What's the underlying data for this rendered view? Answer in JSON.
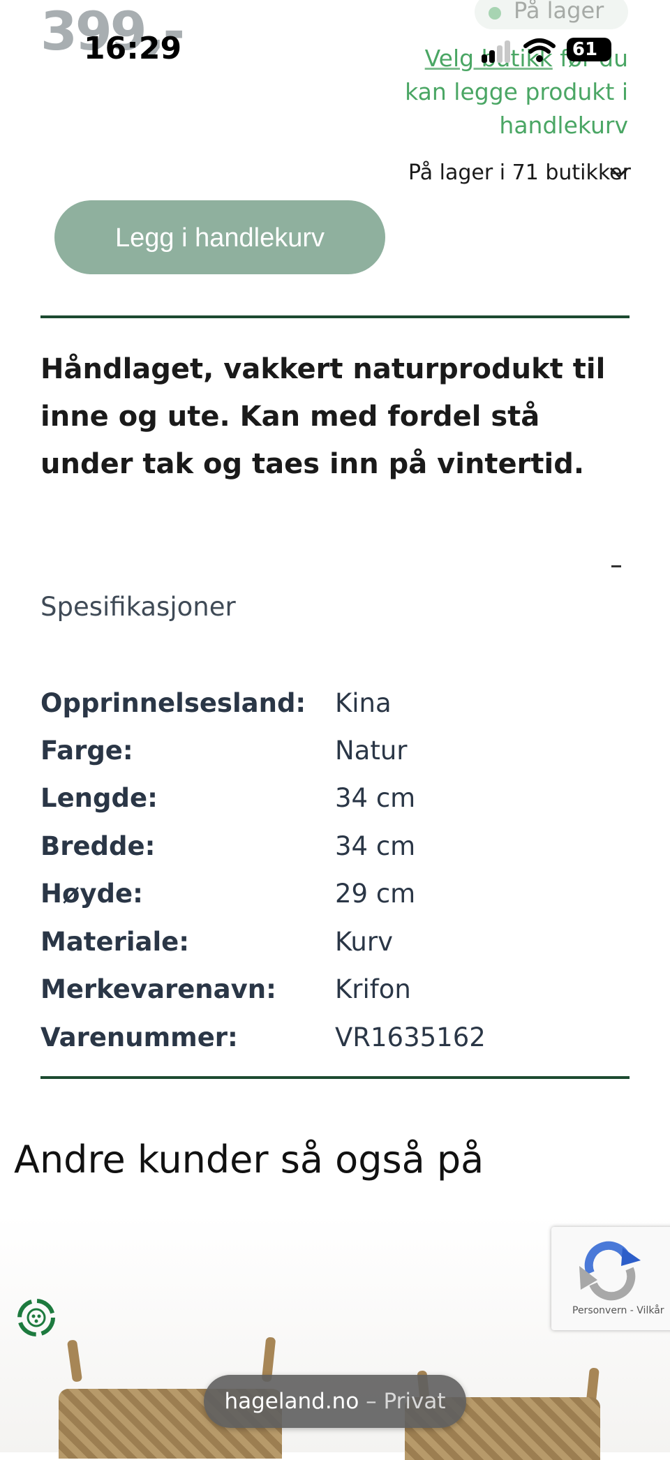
{
  "status_bar": {
    "time": "16:29",
    "battery": "61"
  },
  "product": {
    "price": "399,-",
    "stock_label": "På lager",
    "store_msg_link": "Velg butikk",
    "store_msg_rest": " før du kan legge produkt i handlekurv",
    "stock_count": "På lager i 71 butikker",
    "add_to_cart": "Legg i handlekurv",
    "description": "Håndlaget, vakkert naturprodukt til inne og ute. Kan med fordel stå under tak og taes inn på vintertid."
  },
  "specs": {
    "title": "Spesifikasjoner",
    "collapse": "-",
    "rows": [
      {
        "label": "Opprinnelsesland:",
        "value": "Kina"
      },
      {
        "label": "Farge:",
        "value": "Natur"
      },
      {
        "label": "Lengde:",
        "value": "34 cm"
      },
      {
        "label": "Bredde:",
        "value": "34 cm"
      },
      {
        "label": "Høyde:",
        "value": "29 cm"
      },
      {
        "label": "Materiale:",
        "value": "Kurv"
      },
      {
        "label": "Merkevarenavn:",
        "value": "Krifon"
      },
      {
        "label": "Varenummer:",
        "value": "VR1635162"
      }
    ]
  },
  "recommendations": {
    "title": "Andre kunder så også på"
  },
  "recaptcha": {
    "links": "Personvern - Vilkår"
  },
  "browser": {
    "domain": "hageland.no",
    "mode": "– Privat"
  },
  "colors": {
    "brand_green": "#1c4a30",
    "button": "#8fb09e",
    "link_green": "#4aa664"
  },
  "icons": [
    "signal-icon",
    "wifi-icon",
    "battery-icon",
    "chevron-down-icon",
    "recaptcha-icon",
    "eco-icon"
  ]
}
